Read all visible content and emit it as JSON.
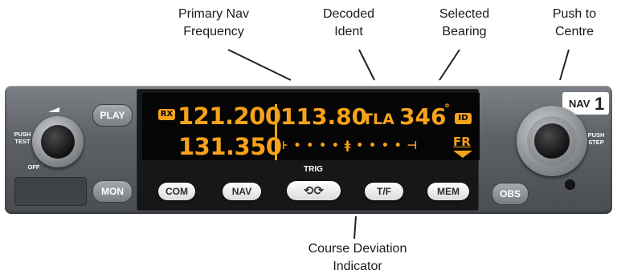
{
  "callouts": {
    "primary_nav": [
      "Primary Nav",
      "Frequency"
    ],
    "decoded_ident": [
      "Decoded",
      "Ident"
    ],
    "selected_bearing": [
      "Selected",
      "Bearing"
    ],
    "push_to_centre": [
      "Push to",
      "Centre"
    ],
    "course_deviation": [
      "Course Deviation",
      "Indicator"
    ]
  },
  "display": {
    "rx_badge": "RX",
    "primary_freq": "121.200",
    "standby_freq": "131.350",
    "nav_freq": "113.80",
    "ident": "TLA",
    "bearing": "346",
    "degree": "°",
    "id_badge": "ID",
    "fr_label": "FR",
    "cdi": "⊦ • • • • ǂ • • • • ⊣"
  },
  "buttons": {
    "play": "PLAY",
    "mon": "MON",
    "com": "COM",
    "nav": "NAV",
    "tf": "T/F",
    "mem": "MEM",
    "obs": "OBS",
    "swap_icon": "swap-arrows-icon"
  },
  "labels": {
    "push_test": [
      "PUSH",
      "TEST"
    ],
    "off": "OFF",
    "push_step": [
      "PUSH",
      "STEP"
    ],
    "brand": "TRIG",
    "nav_tag": "NAV",
    "nav_num": "1"
  },
  "colors": {
    "display": "#f7a21a",
    "bezel": "#5e6267"
  }
}
